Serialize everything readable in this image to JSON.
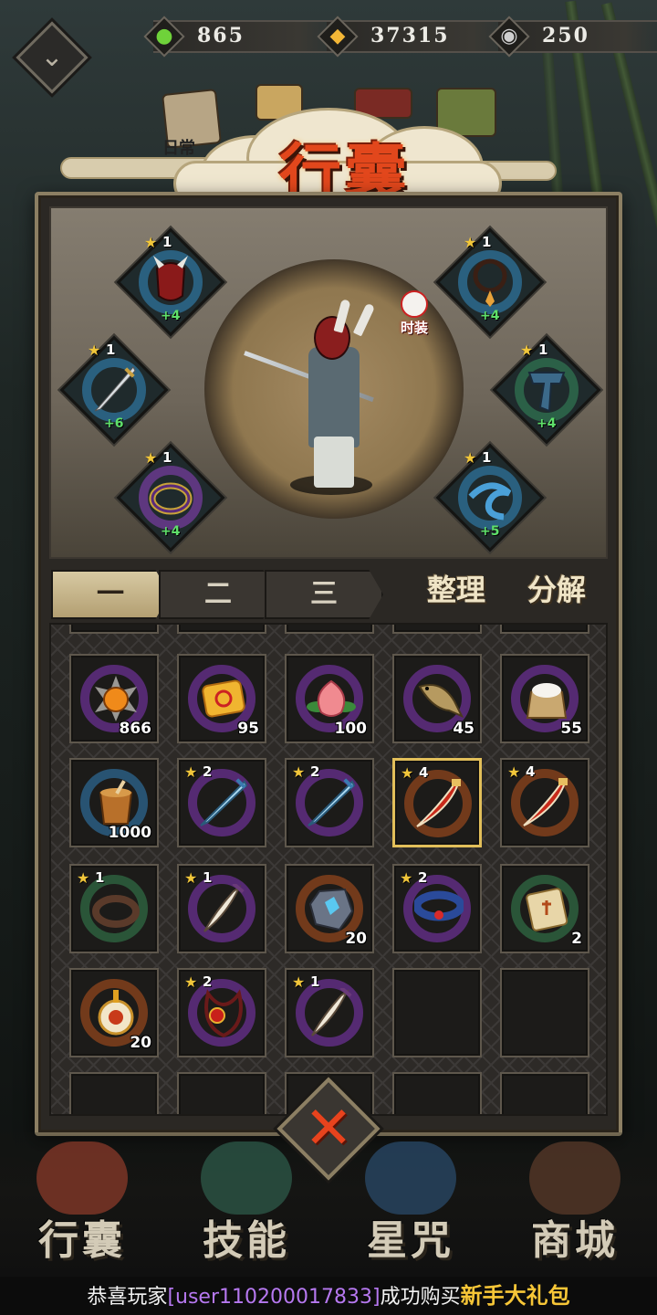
{
  "resources": {
    "jade": {
      "icon": "green-jade-icon",
      "value": "865"
    },
    "coin": {
      "icon": "gold-coin-icon",
      "value": "37315"
    },
    "silver": {
      "icon": "silver-coin-icon",
      "value": "250"
    }
  },
  "categories": {
    "daily_label": "日常"
  },
  "title": "行囊",
  "costume_label": "时装",
  "equipment": [
    {
      "slot": "helmet",
      "icon": "demon-mask-icon",
      "stars": "1",
      "bonus": "+4"
    },
    {
      "slot": "necklace",
      "icon": "bead-necklace-icon",
      "stars": "1",
      "bonus": "+4"
    },
    {
      "slot": "weapon",
      "icon": "sword-icon",
      "stars": "1",
      "bonus": "+6"
    },
    {
      "slot": "armor",
      "icon": "scarf-icon",
      "stars": "1",
      "bonus": "+4"
    },
    {
      "slot": "ring",
      "icon": "purple-ring-icon",
      "stars": "1",
      "bonus": "+4"
    },
    {
      "slot": "belt",
      "icon": "blue-sash-icon",
      "stars": "1",
      "bonus": "+5"
    }
  ],
  "tabs": [
    "一",
    "二",
    "三"
  ],
  "actions": {
    "sort": "整理",
    "decompose": "分解"
  },
  "inventory": [
    {
      "icon": "spirit-orb-icon",
      "count": "866",
      "stars": ""
    },
    {
      "icon": "talisman-scroll-icon",
      "count": "95",
      "stars": ""
    },
    {
      "icon": "peach-icon",
      "count": "100",
      "stars": ""
    },
    {
      "icon": "fish-icon",
      "count": "45",
      "stars": ""
    },
    {
      "icon": "rice-sack-icon",
      "count": "55",
      "stars": ""
    },
    {
      "icon": "wooden-bucket-icon",
      "count": "1000",
      "stars": ""
    },
    {
      "icon": "blue-sword-icon",
      "count": "",
      "stars": "2"
    },
    {
      "icon": "blue-sword-icon",
      "count": "",
      "stars": "2"
    },
    {
      "icon": "red-blade-icon",
      "count": "",
      "stars": "4"
    },
    {
      "icon": "red-blade-icon",
      "count": "",
      "stars": "4"
    },
    {
      "icon": "dark-ring-icon",
      "count": "",
      "stars": "1"
    },
    {
      "icon": "dagger-icon",
      "count": "",
      "stars": "1"
    },
    {
      "icon": "crystal-ore-icon",
      "count": "20",
      "stars": ""
    },
    {
      "icon": "blue-bracelet-icon",
      "count": "",
      "stars": "2"
    },
    {
      "icon": "scroll-icon",
      "count": "2",
      "stars": ""
    },
    {
      "icon": "lion-charm-icon",
      "count": "20",
      "stars": ""
    },
    {
      "icon": "red-pendant-icon",
      "count": "",
      "stars": "2"
    },
    {
      "icon": "dagger-icon",
      "count": "",
      "stars": "1"
    },
    {
      "icon": "",
      "count": "",
      "stars": ""
    },
    {
      "icon": "",
      "count": "",
      "stars": ""
    }
  ],
  "bottom_nav": [
    "行囊",
    "技能",
    "星咒",
    "商城"
  ],
  "ticker": {
    "prefix": "恭喜玩家",
    "user": "[user110200017833]",
    "middle": "成功购买",
    "item": "新手大礼包"
  },
  "colors": {
    "title": "#e2471c",
    "star": "#f1c63a",
    "bonus": "#5fe06a",
    "ticker_user": "#b678f0",
    "ticker_item": "#f7c637"
  }
}
